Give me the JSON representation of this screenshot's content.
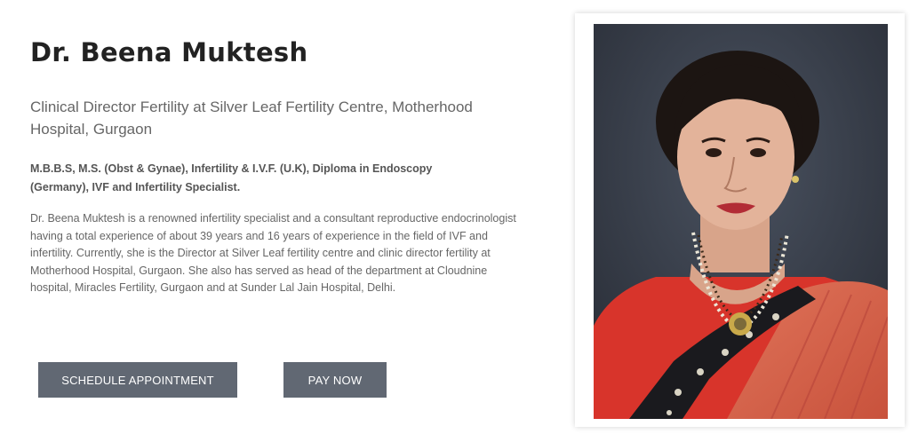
{
  "doctor": {
    "name": "Dr. Beena Muktesh",
    "role": "Clinical Director Fertility at Silver Leaf Fertility Centre, Motherhood Hospital, Gurgaon",
    "qualifications": "M.B.B.S, M.S. (Obst & Gynae), Infertility & I.V.F. (U.K), Diploma in Endoscopy (Germany), IVF and Infertility Specialist.",
    "bio": "Dr. Beena Muktesh is a renowned infertility specialist and a consultant reproductive endocrinologist having a total experience of about 39 years and 16 years of experience in the field of IVF and infertility. Currently, she is the Director at Silver Leaf fertility centre and clinic director fertility at Motherhood Hospital, Gurgaon. She also has served as head of the department at Cloudnine hospital, Miracles Fertility, Gurgaon and at Sunder Lal Jain Hospital, Delhi."
  },
  "actions": {
    "schedule_label": "SCHEDULE APPOINTMENT",
    "pay_label": "PAY NOW"
  },
  "colors": {
    "button_bg": "#616873",
    "heading": "#222222",
    "text": "#666666"
  },
  "photo": {
    "icon": "doctor-portrait"
  }
}
